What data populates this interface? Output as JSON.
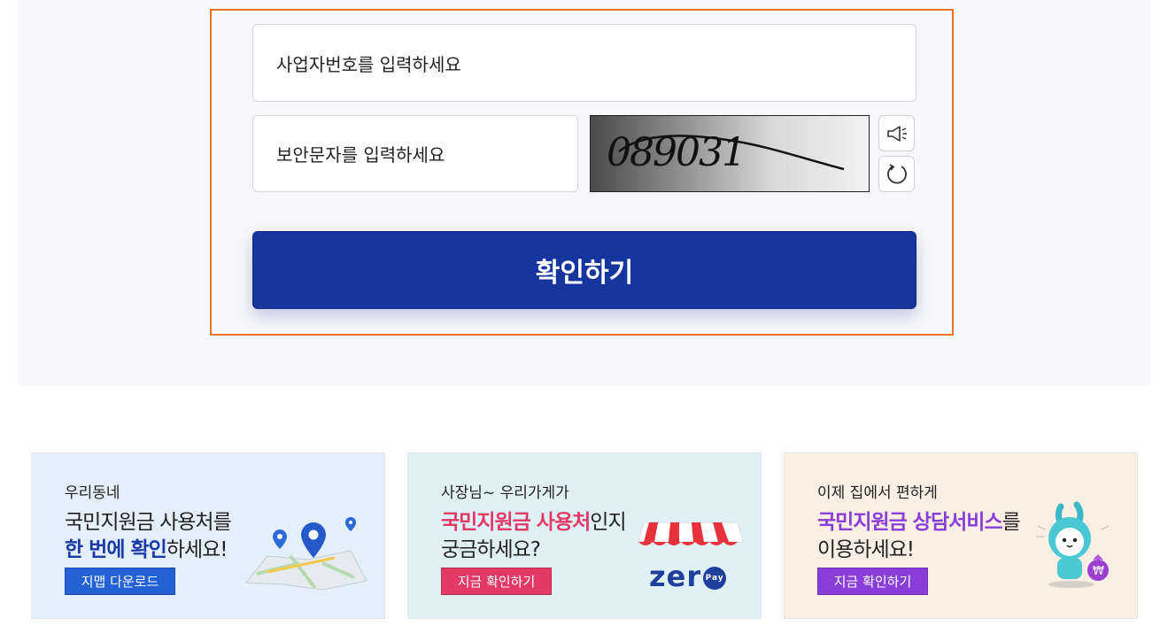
{
  "form": {
    "business_number_placeholder": "사업자번호를 입력하세요",
    "security_text_placeholder": "보안문자를 입력하세요",
    "captcha_text": "089031",
    "confirm_label": "확인하기"
  },
  "banners": [
    {
      "small": "우리동네",
      "line1": "국민지원금 사용처를",
      "line2_strong": "한 번에 확인",
      "line2_rest": "하세요!",
      "button": "지맵 다운로드"
    },
    {
      "small": "사장님~ 우리가게가",
      "line1_strong": "국민지원금 사용처",
      "line1_rest": "인지",
      "line2": "궁금하세요?",
      "button": "지금 확인하기",
      "logo_text": "zer",
      "logo_pay": "Pay"
    },
    {
      "small": "이제 집에서 편하게",
      "line1_strong": "국민지원금 상담서비스",
      "line1_rest": "를",
      "line2": "이용하세요!",
      "button": "지금 확인하기",
      "bag_symbol": "₩"
    }
  ],
  "colors": {
    "frame_border": "#e8742a",
    "confirm_button": "#16369e",
    "blue_button": "#2461d6",
    "red_button": "#e23a64",
    "purple_button": "#8a3ed8"
  },
  "icons": [
    "speaker-icon",
    "refresh-icon",
    "map-pin-icon",
    "awning-icon",
    "mascot-icon"
  ]
}
